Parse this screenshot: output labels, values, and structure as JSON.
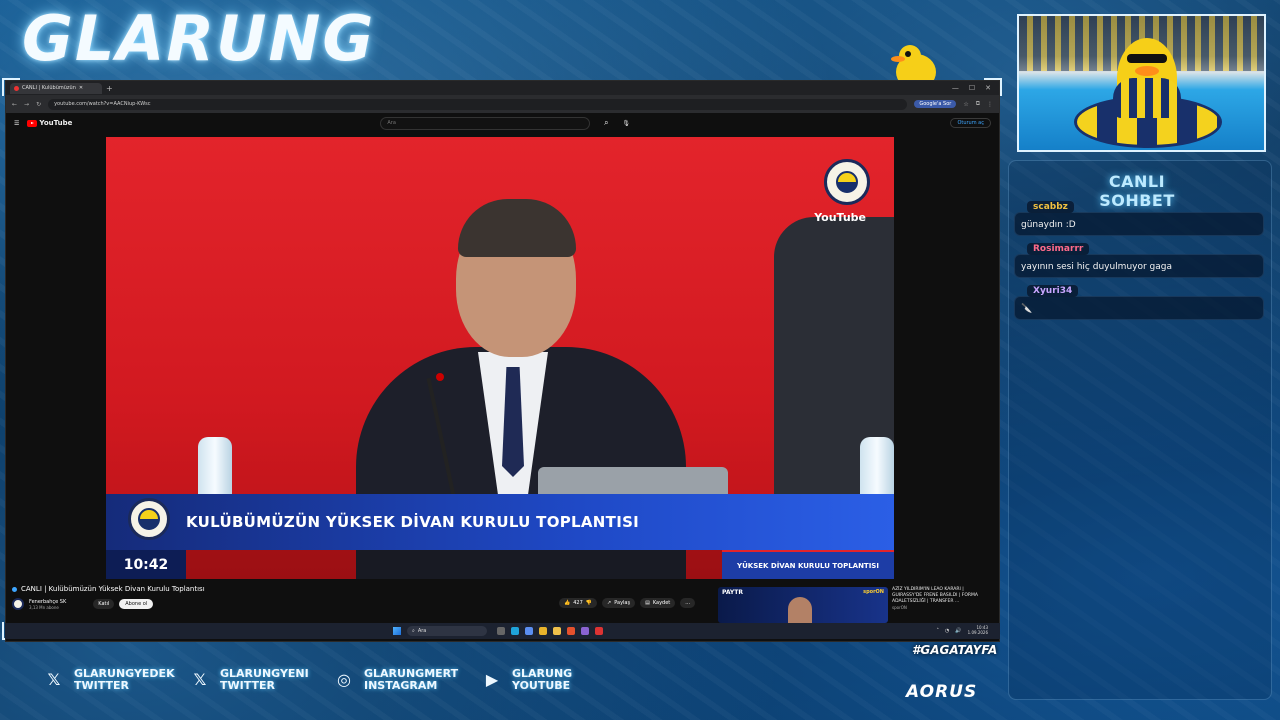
{
  "overlay": {
    "stream_title": "GLARUNG",
    "chat_header": "CANLI SOHBET",
    "hashtag": "#GAGATAYFA",
    "brand": "AORUS"
  },
  "browser": {
    "tab_title": "CANLI | Kulübümüzün",
    "url": "youtube.com/watch?v=AACNiup-KWsc",
    "google_btn": "Google'a Sor"
  },
  "youtube": {
    "logo": "YouTube",
    "search_placeholder": "Ara",
    "sign_in": "Oturum aç",
    "watermark": "YouTube",
    "banner_text": "KULÜBÜMÜZÜN YÜKSEK DİVAN KURULU TOPLANTISI",
    "banner_time": "10:42",
    "banner_tag": "YÜKSEK DİVAN KURULU TOPLANTISI",
    "video_title": "CANLI | Kulübümüzün Yüksek Divan Kurulu Toplantısı",
    "channel_name": "Fenerbahçe SK",
    "subscribers": "3,13 Mn abone",
    "join": "Katıl",
    "subscribe": "Abone ol",
    "likes": "427",
    "share": "Paylaş",
    "save": "Kaydet",
    "more": "..."
  },
  "recommendation": {
    "thumb_label": "PAYTR",
    "thumb_brand": "sporON",
    "title": "AZİZ YILDIRIM'IN LEAO KARARI | GUIRASSY'DE FRENE BASILDI | FORMA ADALETSİZLİĞİ | TRANSFER ...",
    "channel": "sporON"
  },
  "taskbar": {
    "search": "Ara",
    "time": "10:43",
    "date": "1.09.2026"
  },
  "chat": [
    {
      "user": "scabbz",
      "user_color": "#f0c040",
      "text": "günaydın :D"
    },
    {
      "user": "Rosimarrr",
      "user_color": "#ff6b8a",
      "text": "yayının sesi hiç duyulmuyor gaga"
    },
    {
      "user": "Xyuri34",
      "user_color": "#c9a6ff",
      "text": "🔪"
    }
  ],
  "socials": [
    {
      "icon": "x-icon",
      "line1": "GLARUNGYEDEK",
      "line2": "TWITTER"
    },
    {
      "icon": "x-icon",
      "line1": "GLARUNGYENI",
      "line2": "TWITTER"
    },
    {
      "icon": "instagram-icon",
      "line1": "GLARUNGMERT",
      "line2": "INSTAGRAM"
    },
    {
      "icon": "youtube-icon",
      "line1": "GLARUNG",
      "line2": "YOUTUBE"
    }
  ],
  "colors": {
    "accent": "#5cc9ff",
    "fener_yellow": "#f4d21e",
    "fener_navy": "#18306b",
    "yt_red": "#ff0000"
  }
}
